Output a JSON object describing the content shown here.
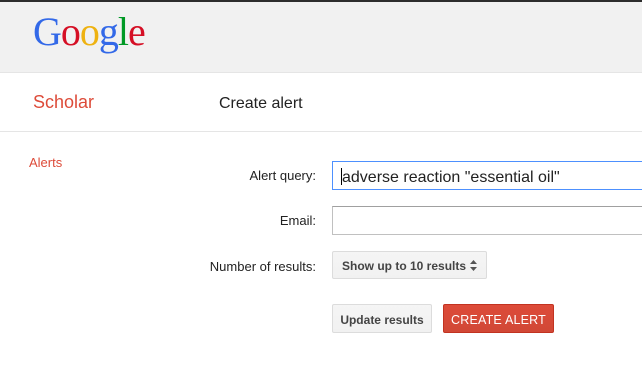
{
  "header": {
    "logo_letters": [
      {
        "char": "G",
        "color": "#3369e8"
      },
      {
        "char": "o",
        "color": "#d50f25"
      },
      {
        "char": "o",
        "color": "#eeb211"
      },
      {
        "char": "g",
        "color": "#3369e8"
      },
      {
        "char": "l",
        "color": "#009925"
      },
      {
        "char": "e",
        "color": "#d50f25"
      }
    ]
  },
  "subheader": {
    "product": "Scholar",
    "page_title": "Create alert"
  },
  "sidebar": {
    "alerts_link": "Alerts"
  },
  "form": {
    "query_label": "Alert query:",
    "query_value": "adverse reaction \"essential oil\"",
    "email_label": "Email:",
    "email_value": "",
    "num_results_label": "Number of results:",
    "num_results_prefix": "Show up to",
    "num_results_value": "10 results",
    "update_button": "Update results",
    "create_button": "CREATE ALERT"
  },
  "colors": {
    "accent": "#dd4b39",
    "focus_border": "#4d90fe"
  }
}
